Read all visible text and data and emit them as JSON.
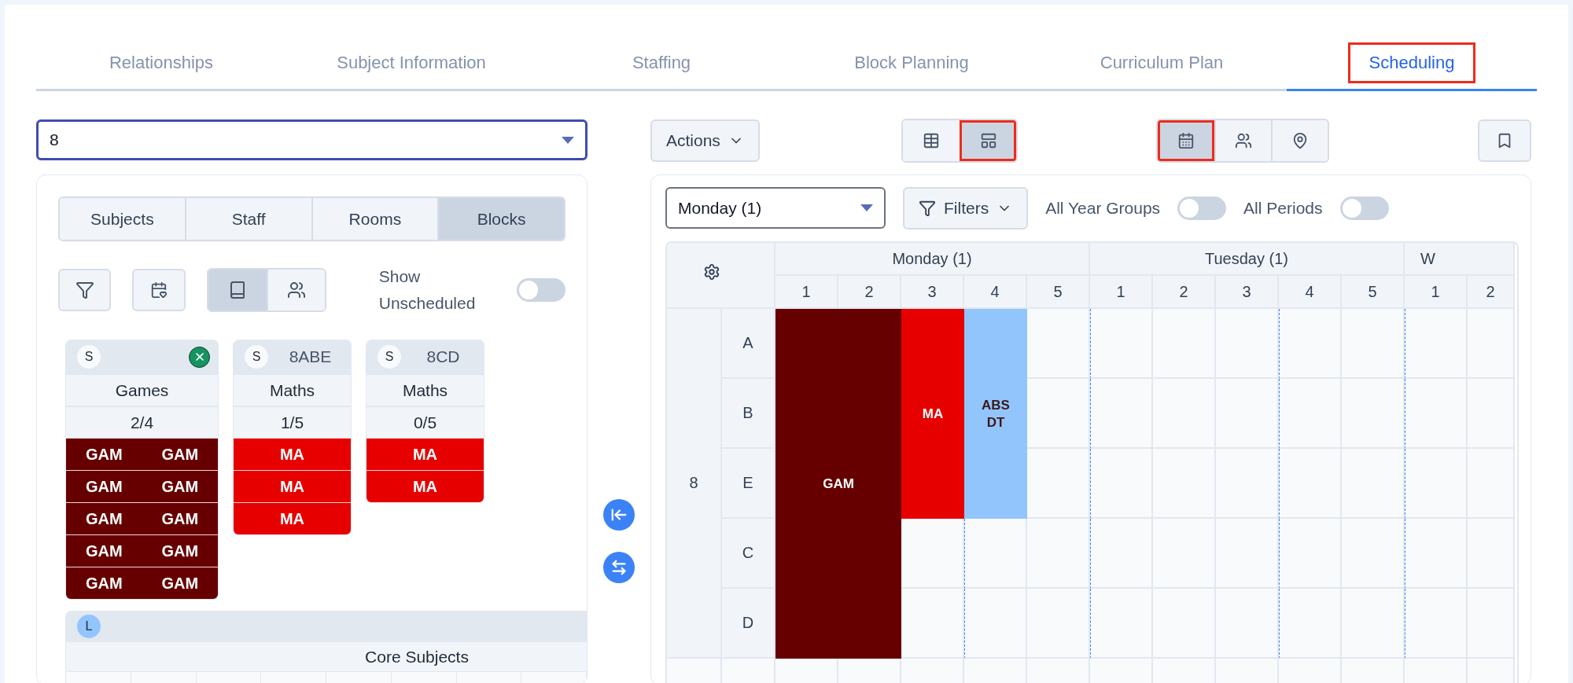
{
  "tabs": [
    {
      "label": "Relationships",
      "selected": false,
      "annotated": false
    },
    {
      "label": "Subject Information",
      "selected": false,
      "annotated": false
    },
    {
      "label": "Staffing",
      "selected": false,
      "annotated": false
    },
    {
      "label": "Block Planning",
      "selected": false,
      "annotated": false
    },
    {
      "label": "Curriculum Plan",
      "selected": false,
      "annotated": false
    },
    {
      "label": "Scheduling",
      "selected": true,
      "annotated": true
    }
  ],
  "left": {
    "year_select": {
      "value": "8"
    },
    "panel_tabs": [
      {
        "label": "Subjects",
        "selected": false
      },
      {
        "label": "Staff",
        "selected": false
      },
      {
        "label": "Rooms",
        "selected": false
      },
      {
        "label": "Blocks",
        "selected": true
      }
    ],
    "view_toggle": [
      {
        "kind": "book",
        "selected": true
      },
      {
        "kind": "people",
        "selected": false
      }
    ],
    "show_unscheduled": {
      "label": "Show Unscheduled",
      "on": false
    },
    "blocks": [
      {
        "badge": "S",
        "removable": true,
        "subject": "Games",
        "count": "2/4",
        "color": "#660000",
        "cells": [
          [
            "GAM",
            "GAM"
          ],
          [
            "GAM",
            "GAM"
          ],
          [
            "GAM",
            "GAM"
          ],
          [
            "GAM",
            "GAM"
          ],
          [
            "GAM",
            "GAM"
          ]
        ]
      },
      {
        "badge": "S",
        "code": "8ABE",
        "removable": false,
        "subject": "Maths",
        "count": "1/5",
        "color": "#e60000",
        "cells": [
          [
            "MA"
          ],
          [
            "MA"
          ],
          [
            "MA"
          ]
        ]
      },
      {
        "badge": "S",
        "code": "8CD",
        "removable": false,
        "subject": "Maths",
        "count": "0/5",
        "color": "#e60000",
        "cells": [
          [
            "MA"
          ],
          [
            "MA"
          ]
        ]
      }
    ],
    "group": {
      "badge": "L",
      "title": "Core Subjects"
    }
  },
  "right": {
    "actions": {
      "label": "Actions"
    },
    "layout_toggle": [
      {
        "kind": "table",
        "selected": false,
        "annotated": false
      },
      {
        "kind": "table-alt",
        "selected": true,
        "annotated": true
      }
    ],
    "view_modes": [
      {
        "kind": "calendar",
        "selected": true,
        "annotated": true
      },
      {
        "kind": "people",
        "selected": false,
        "annotated": false
      },
      {
        "kind": "location",
        "selected": false,
        "annotated": false
      }
    ],
    "day_select": {
      "value": "Monday (1)"
    },
    "filters": {
      "label": "Filters"
    },
    "toggles": [
      {
        "label": "All Year Groups",
        "on": false
      },
      {
        "label": "All Periods",
        "on": false
      }
    ],
    "grid": {
      "year": "8",
      "rows": [
        "A",
        "B",
        "E",
        "C",
        "D"
      ],
      "days": [
        {
          "name": "Monday (1)",
          "periods": [
            "1",
            "2",
            "3",
            "4",
            "5"
          ]
        },
        {
          "name": "Tuesday (1)",
          "periods": [
            "1",
            "2",
            "3",
            "4",
            "5"
          ]
        },
        {
          "name": "W",
          "periods": [
            "1",
            "2"
          ]
        }
      ],
      "lessons": [
        {
          "labels": [
            "GAM"
          ],
          "color": "#660000"
        },
        {
          "labels": [
            "MA"
          ],
          "color": "#e60000"
        },
        {
          "labels": [
            "ABS",
            "DT"
          ],
          "color": "#93c5fd"
        }
      ]
    }
  }
}
